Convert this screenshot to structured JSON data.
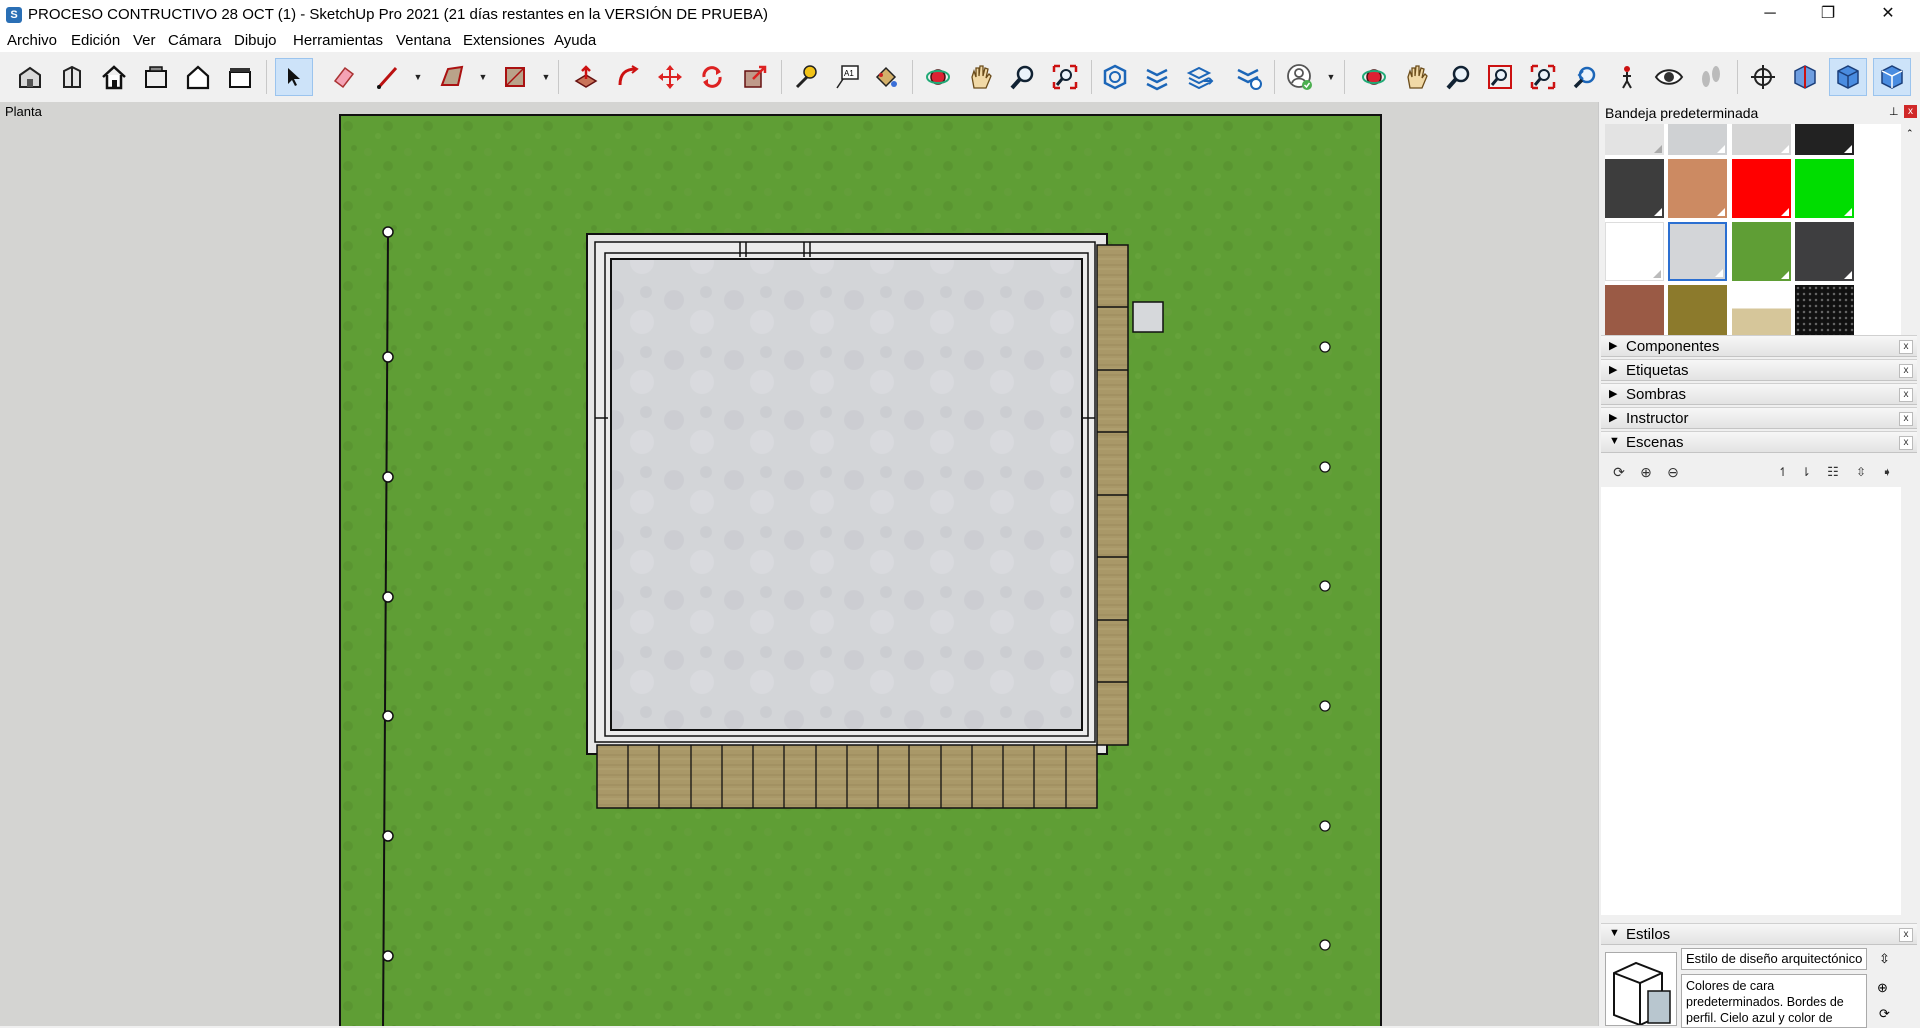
{
  "window": {
    "title": "PROCESO CONTRUCTIVO 28 OCT (1) - SketchUp Pro 2021 (21 días restantes en la VERSIÓN DE PRUEBA)",
    "minimize": "─",
    "maximize": "❐",
    "close": "✕"
  },
  "menu": [
    "Archivo",
    "Edición",
    "Ver",
    "Cámara",
    "Dibujo",
    "Herramientas",
    "Ventana",
    "Extensiones",
    "Ayuda"
  ],
  "viewport": {
    "view_label": "Planta"
  },
  "tray": {
    "title": "Bandeja predeterminada",
    "pin": "📌",
    "close": "x",
    "panels": {
      "componentes": "Componentes",
      "etiquetas": "Etiquetas",
      "sombras": "Sombras",
      "instructor": "Instructor",
      "escenas": "Escenas",
      "estilos": "Estilos"
    },
    "panel_close": "x",
    "collapsed_arrow": "▶",
    "expanded_arrow": "▼",
    "style_name": "Estilo de diseño arquitectónico",
    "style_description": "Colores de cara predeterminados. Bordes de perfil. Cielo azul y color de"
  },
  "colors": {
    "grass": "#5f9e35",
    "concrete": "#d2d4d6",
    "wood": "#a89668",
    "wall": "#e2e2e2",
    "active_tool": "#cde3f9"
  }
}
